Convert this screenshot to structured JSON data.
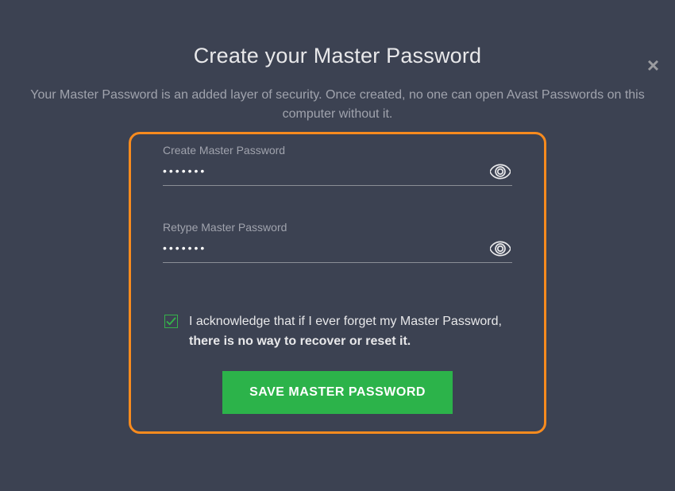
{
  "close": "×",
  "title": "Create your Master Password",
  "subtitle": "Your Master Password is an added layer of security. Once created, no one can open Avast Passwords on this computer without it.",
  "fields": {
    "create": {
      "label": "Create Master Password",
      "value": "•••••••"
    },
    "retype": {
      "label": "Retype Master Password",
      "value": "•••••••"
    }
  },
  "acknowledge": {
    "checked": true,
    "text_pre": "I acknowledge that if I ever forget my Master Password, ",
    "text_bold": "there is no way to recover or reset it."
  },
  "save_button": "SAVE MASTER PASSWORD"
}
